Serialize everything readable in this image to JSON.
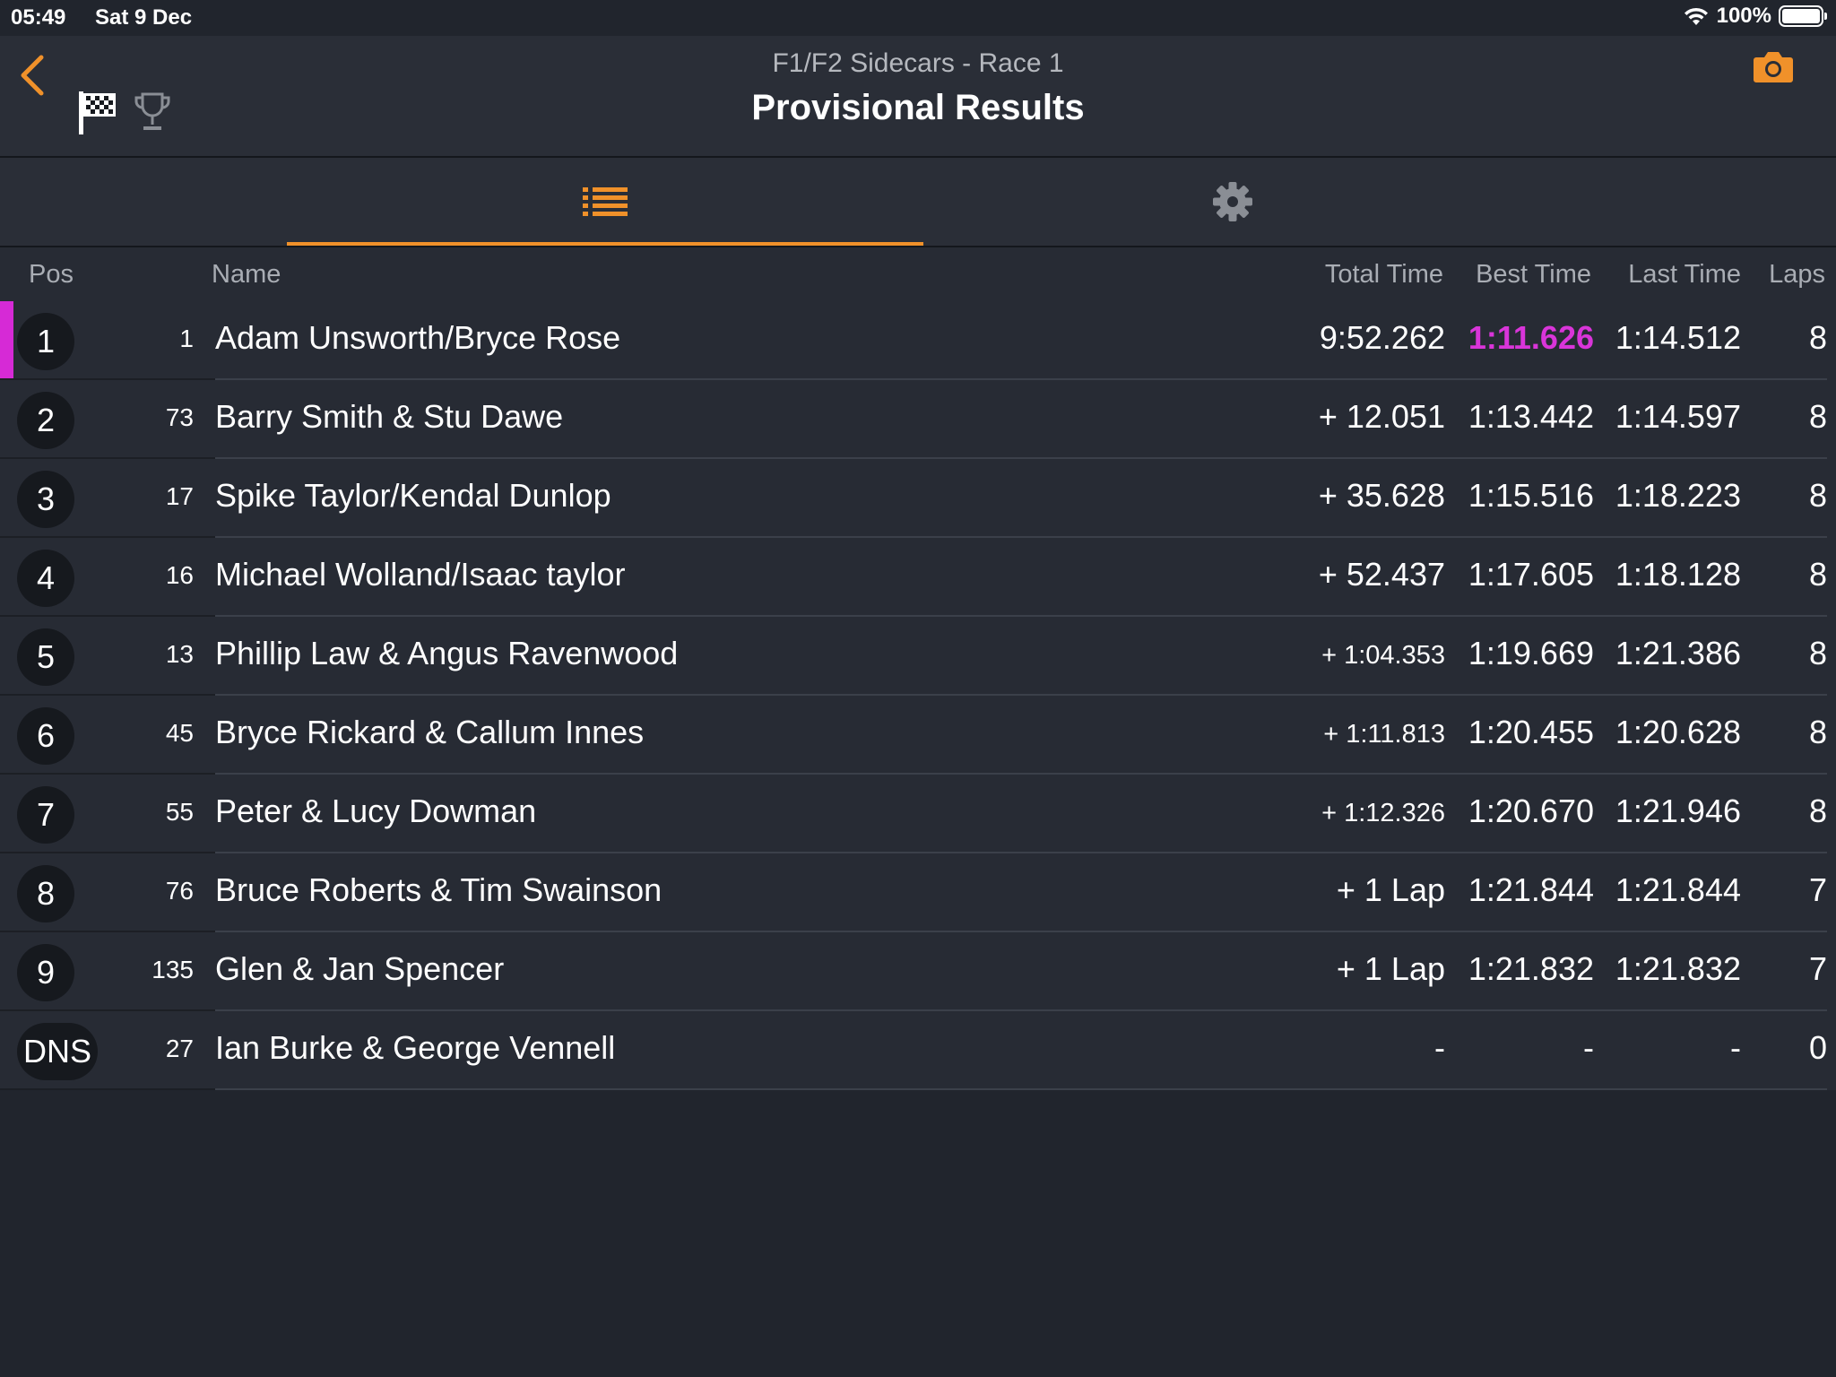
{
  "status_bar": {
    "time": "05:49",
    "date": "Sat 9 Dec",
    "battery_pct": "100%"
  },
  "header": {
    "subtitle": "F1/F2 Sidecars - Race 1",
    "title": "Provisional Results"
  },
  "icons": {
    "back": "chevron-left-icon",
    "flag": "checkered-flag-icon",
    "trophy": "trophy-icon",
    "camera": "camera-icon",
    "list_tab": "list-icon",
    "settings_tab": "gear-icon"
  },
  "colors": {
    "accent": "#f0912a",
    "fastest_lap": "#d935d9",
    "background": "#21252d",
    "row_background": "#272b34"
  },
  "table": {
    "headers": {
      "pos": "Pos",
      "name": "Name",
      "total": "Total Time",
      "best": "Best Time",
      "last": "Last Time",
      "laps": "Laps"
    },
    "rows": [
      {
        "pos": "1",
        "num": "1",
        "name": "Adam Unsworth/Bryce Rose",
        "total": "9:52.262",
        "best": "1:11.626",
        "last": "1:14.512",
        "laps": "8"
      },
      {
        "pos": "2",
        "num": "73",
        "name": "Barry Smith & Stu Dawe",
        "total": "+ 12.051",
        "best": "1:13.442",
        "last": "1:14.597",
        "laps": "8"
      },
      {
        "pos": "3",
        "num": "17",
        "name": "Spike Taylor/Kendal Dunlop",
        "total": "+ 35.628",
        "best": "1:15.516",
        "last": "1:18.223",
        "laps": "8"
      },
      {
        "pos": "4",
        "num": "16",
        "name": "Michael Wolland/Isaac taylor",
        "total": "+ 52.437",
        "best": "1:17.605",
        "last": "1:18.128",
        "laps": "8"
      },
      {
        "pos": "5",
        "num": "13",
        "name": "Phillip Law & Angus Ravenwood",
        "total": "+ 1:04.353",
        "best": "1:19.669",
        "last": "1:21.386",
        "laps": "8"
      },
      {
        "pos": "6",
        "num": "45",
        "name": "Bryce Rickard & Callum Innes",
        "total": "+ 1:11.813",
        "best": "1:20.455",
        "last": "1:20.628",
        "laps": "8"
      },
      {
        "pos": "7",
        "num": "55",
        "name": "Peter & Lucy Dowman",
        "total": "+ 1:12.326",
        "best": "1:20.670",
        "last": "1:21.946",
        "laps": "8"
      },
      {
        "pos": "8",
        "num": "76",
        "name": "Bruce Roberts & Tim Swainson",
        "total": "+ 1 Lap",
        "best": "1:21.844",
        "last": "1:21.844",
        "laps": "7"
      },
      {
        "pos": "9",
        "num": "135",
        "name": "Glen & Jan Spencer",
        "total": "+ 1 Lap",
        "best": "1:21.832",
        "last": "1:21.832",
        "laps": "7"
      },
      {
        "pos": "DNS",
        "num": "27",
        "name": "Ian Burke & George Vennell",
        "total": "-",
        "best": "-",
        "last": "-",
        "laps": "0"
      }
    ]
  }
}
